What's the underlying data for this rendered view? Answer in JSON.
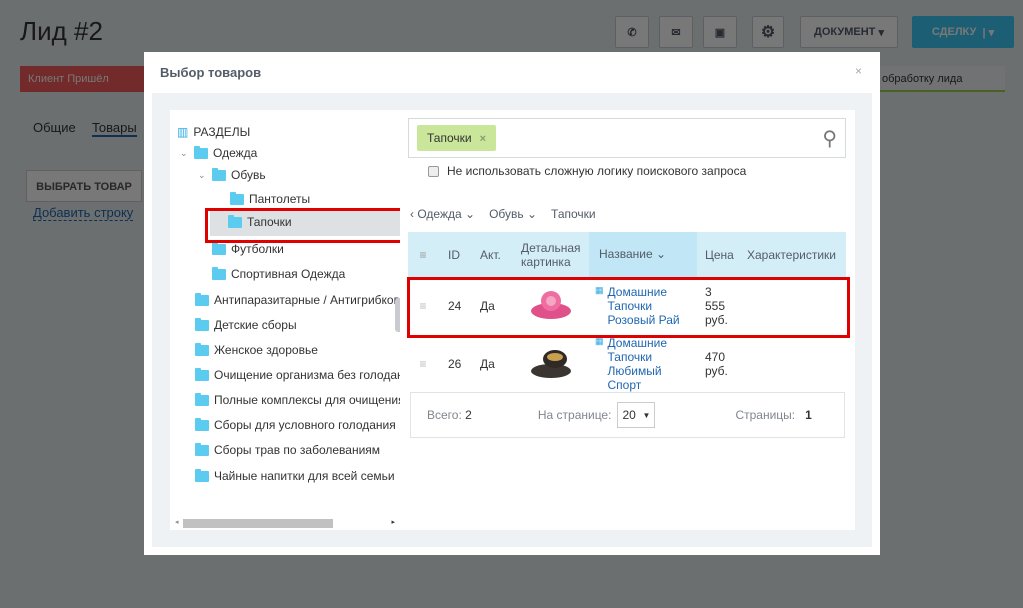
{
  "page": {
    "title": "Лид #2",
    "document_btn": "ДОКУМЕНТ",
    "deal_btn": "СДЕЛКУ",
    "stage_left": "Клиент Пришёл",
    "stage_right": "обработку лида",
    "tabs": [
      "Общие",
      "Товары"
    ],
    "select_product": "ВЫБРАТЬ ТОВАР",
    "add_row": "Добавить строку"
  },
  "modal": {
    "title": "Выбор товаров",
    "close": "×"
  },
  "tree": {
    "root": "РАЗДЕЛЫ",
    "items": [
      {
        "label": "Одежда"
      },
      {
        "label": "Обувь"
      },
      {
        "label": "Пантолеты"
      },
      {
        "label": "Тапочки"
      },
      {
        "label": "Футболки"
      },
      {
        "label": "Спортивная Одежда"
      },
      {
        "label": "Антипаразитарные / Антигрибковые"
      },
      {
        "label": "Детские сборы"
      },
      {
        "label": "Женское здоровье"
      },
      {
        "label": "Очищение организма без голодания"
      },
      {
        "label": "Полные комплексы для очищения организма"
      },
      {
        "label": "Сборы для условного голодания"
      },
      {
        "label": "Сборы трав по заболеваниям"
      },
      {
        "label": "Чайные напитки для всей семьи"
      }
    ]
  },
  "search": {
    "tag": "Тапочки",
    "tag_remove": "×",
    "checkbox_label": "Не использовать сложную логику поискового запроса"
  },
  "breadcrumb": [
    "Одежда",
    "Обувь",
    "Тапочки"
  ],
  "table": {
    "headers": [
      "ID",
      "Акт.",
      "Детальная картинка",
      "Название",
      "Цена",
      "Характеристики"
    ],
    "rows": [
      {
        "id": "24",
        "active": "Да",
        "name": "Домашние Тапочки Розовый Рай",
        "price": "3 555 руб."
      },
      {
        "id": "26",
        "active": "Да",
        "name": "Домашние Тапочки Любимый Спорт",
        "price": "470 руб."
      }
    ]
  },
  "footer": {
    "total_label": "Всего:",
    "total": "2",
    "per_page_label": "На странице:",
    "per_page": "20",
    "pages_label": "Страницы:",
    "page": "1"
  }
}
